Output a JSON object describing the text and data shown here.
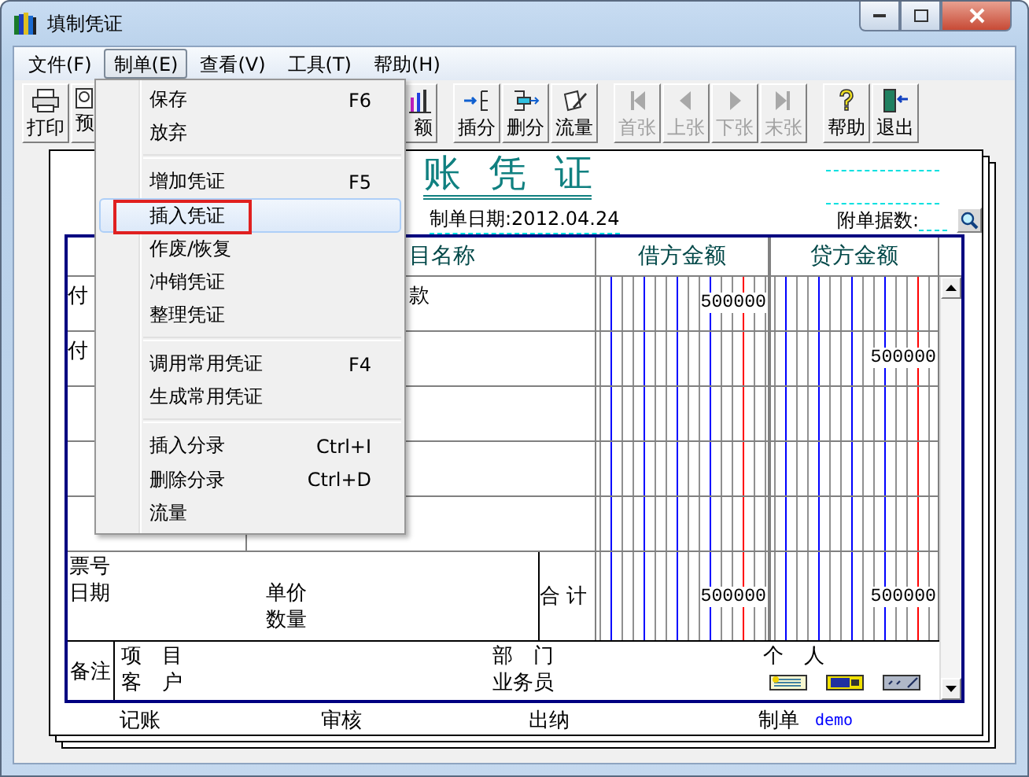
{
  "window": {
    "title": "填制凭证"
  },
  "menubar": [
    {
      "label": "文件(F)",
      "selected": false
    },
    {
      "label": "制单(E)",
      "selected": true
    },
    {
      "label": "查看(V)",
      "selected": false
    },
    {
      "label": "工具(T)",
      "selected": false
    },
    {
      "label": "帮助(H)",
      "selected": false
    }
  ],
  "toolbar": [
    {
      "buttons": [
        {
          "label": "打印",
          "disabled": false
        },
        {
          "label": "预",
          "disabled": false
        },
        {
          "label": "额",
          "disabled": false
        }
      ]
    },
    {
      "buttons": [
        {
          "label": "插分",
          "disabled": false
        },
        {
          "label": "删分",
          "disabled": false
        },
        {
          "label": "流量",
          "disabled": false
        }
      ]
    },
    {
      "buttons": [
        {
          "label": "首张",
          "disabled": true
        },
        {
          "label": "上张",
          "disabled": true
        },
        {
          "label": "下张",
          "disabled": true
        },
        {
          "label": "末张",
          "disabled": true
        }
      ]
    },
    {
      "buttons": [
        {
          "label": "帮助",
          "disabled": false
        },
        {
          "label": "退出",
          "disabled": false
        }
      ]
    }
  ],
  "menu": {
    "sections": [
      {
        "items": [
          {
            "label": "保存",
            "shortcut": "F6",
            "selected": false
          },
          {
            "label": "放弃",
            "selected": false
          }
        ]
      },
      {
        "items": [
          {
            "label": "增加凭证",
            "shortcut": "F5",
            "selected": false
          },
          {
            "label": "插入凭证",
            "selected": true
          },
          {
            "label": "作废/恢复",
            "selected": false
          },
          {
            "label": "冲销凭证",
            "selected": false
          },
          {
            "label": "整理凭证",
            "selected": false
          }
        ]
      },
      {
        "items": [
          {
            "label": "调用常用凭证",
            "shortcut": "F4",
            "selected": false
          },
          {
            "label": "生成常用凭证",
            "selected": false
          }
        ]
      },
      {
        "items": [
          {
            "label": "插入分录",
            "shortcut": "Ctrl+I",
            "selected": false
          },
          {
            "label": "删除分录",
            "shortcut": "Ctrl+D",
            "selected": false
          },
          {
            "label": "流量",
            "selected": false
          }
        ]
      }
    ]
  },
  "voucher": {
    "title": "账 凭 证",
    "date": "制单日期:2012.04.24",
    "attachments_label": "附单据数:",
    "columns": [
      "目名称",
      "借方金额",
      "贷方金额"
    ],
    "rows": [
      {
        "summary": "付",
        "account": "款",
        "debit": "500000"
      },
      {
        "summary": "付",
        "credit": "500000"
      }
    ],
    "ticket_no_label": "票号",
    "date_label": "日期",
    "unit_price_label": "单价",
    "quantity_label": "数量",
    "total_label": "合 计",
    "total_debit": "500000",
    "total_credit": "500000",
    "remarks_label": "备注",
    "project_label": "项　目",
    "customer_label": "客　户",
    "department_label": "部　门",
    "salesperson_label": "业务员",
    "individual_label": "个　人",
    "signatures": [
      {
        "label": "记账"
      },
      {
        "label": "审核"
      },
      {
        "label": "出纳"
      },
      {
        "label": "制单",
        "value": "demo"
      }
    ]
  }
}
